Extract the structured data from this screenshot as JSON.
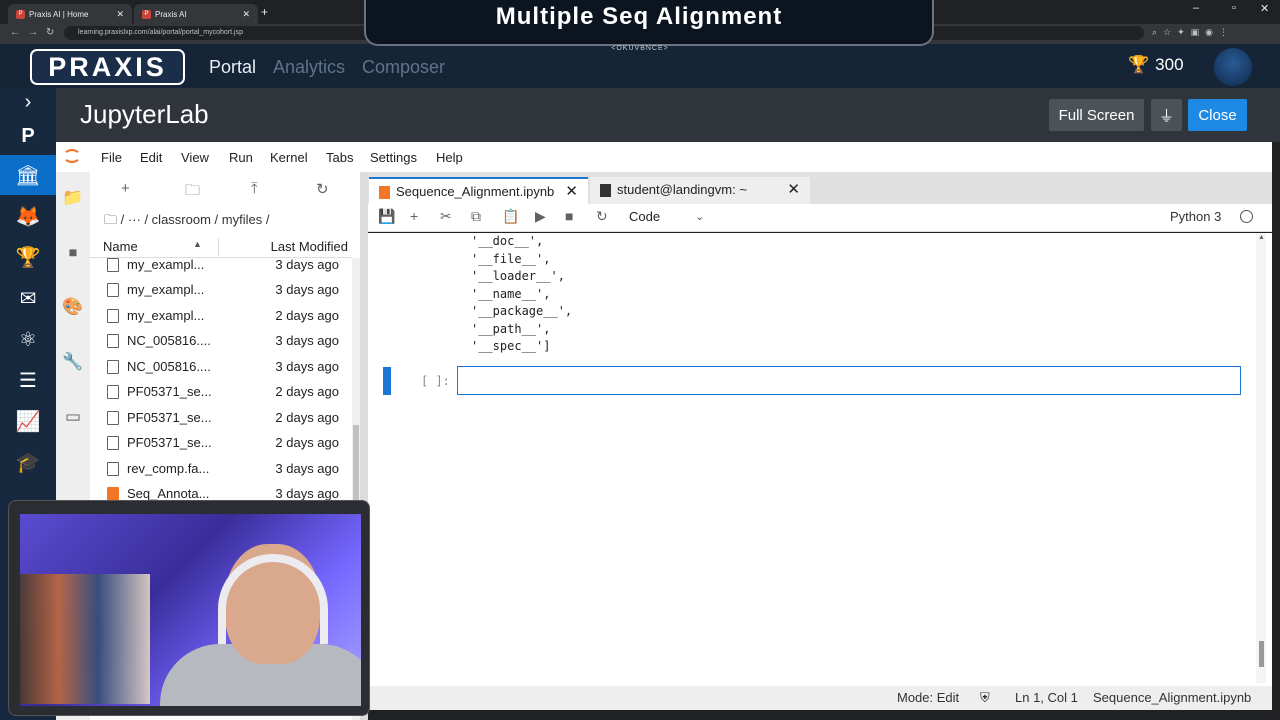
{
  "browser": {
    "tab1_title": "Praxis AI | Home",
    "tab2_title": "Praxis AI",
    "url": "learning.praxislxp.com/alai/portal/portal_mycohort.jsp"
  },
  "overlay": {
    "title": "Multiple Seq Alignment",
    "subtitle": "<OKUVBNCE>"
  },
  "praxis": {
    "logo": "PRAXIS",
    "nav": [
      "Portal",
      "Analytics",
      "Composer"
    ],
    "score": "300"
  },
  "jupyter": {
    "title": "JupyterLab",
    "full_screen": "Full Screen",
    "close": "Close",
    "menu": [
      "File",
      "Edit",
      "View",
      "Run",
      "Kernel",
      "Tabs",
      "Settings",
      "Help"
    ]
  },
  "filebrowser": {
    "breadcrumb": "/ ··· / classroom / myfiles /",
    "col_name": "Name",
    "col_modified": "Last Modified",
    "files": [
      {
        "name": "my_exampl...",
        "modified": "3 days ago"
      },
      {
        "name": "my_exampl...",
        "modified": "3 days ago"
      },
      {
        "name": "my_exampl...",
        "modified": "2 days ago"
      },
      {
        "name": "NC_005816....",
        "modified": "3 days ago"
      },
      {
        "name": "NC_005816....",
        "modified": "3 days ago"
      },
      {
        "name": "PF05371_se...",
        "modified": "2 days ago"
      },
      {
        "name": "PF05371_se...",
        "modified": "2 days ago"
      },
      {
        "name": "PF05371_se...",
        "modified": "2 days ago"
      },
      {
        "name": "rev_comp.fa...",
        "modified": "3 days ago"
      },
      {
        "name": "Seq_Annota...",
        "modified": "3 days ago"
      }
    ]
  },
  "notebook": {
    "tabs": [
      "Sequence_Alignment.ipynb",
      "student@landingvm: ~"
    ],
    "cell_type": "Code",
    "kernel": "Python 3",
    "output_lines": [
      "'__doc__',",
      "'__file__',",
      "'__loader__',",
      "'__name__',",
      "'__package__',",
      "'__path__',",
      "'__spec__']"
    ],
    "prompt": "[ ]:"
  },
  "status": {
    "mode": "Mode: Edit",
    "position": "Ln 1, Col 1",
    "filename": "Sequence_Alignment.ipynb"
  }
}
